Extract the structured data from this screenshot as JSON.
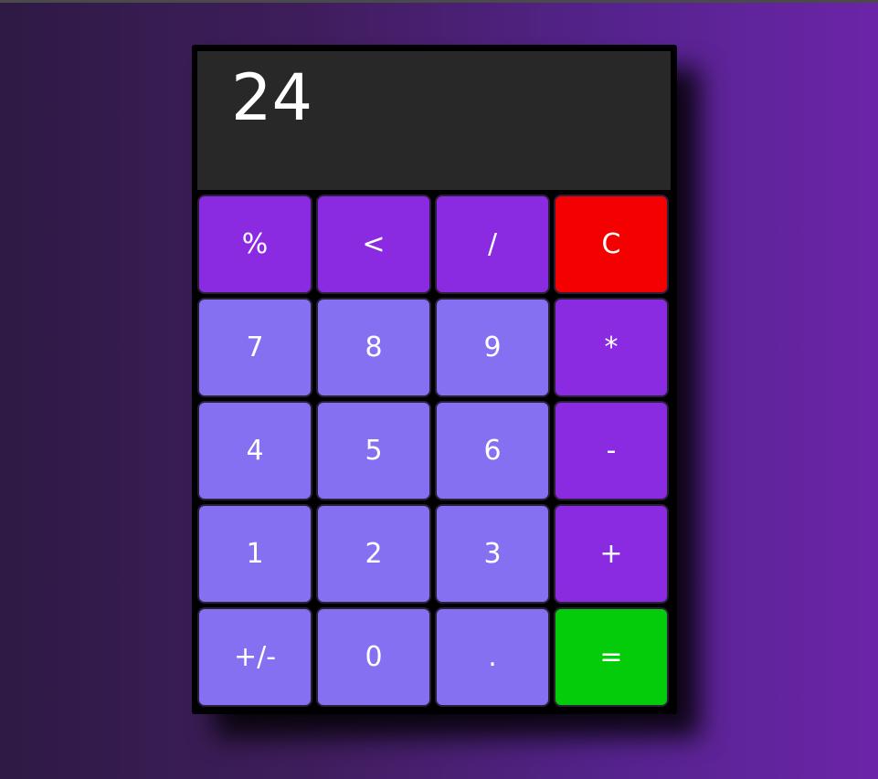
{
  "calculator": {
    "display_value": "24",
    "keys": [
      {
        "label": "%",
        "kind": "op",
        "name": "percent-button"
      },
      {
        "label": "<",
        "kind": "op",
        "name": "backspace-button"
      },
      {
        "label": "/",
        "kind": "op",
        "name": "divide-button"
      },
      {
        "label": "C",
        "kind": "clear",
        "name": "clear-button"
      },
      {
        "label": "7",
        "kind": "num",
        "name": "digit-7-button"
      },
      {
        "label": "8",
        "kind": "num",
        "name": "digit-8-button"
      },
      {
        "label": "9",
        "kind": "num",
        "name": "digit-9-button"
      },
      {
        "label": "*",
        "kind": "op",
        "name": "multiply-button"
      },
      {
        "label": "4",
        "kind": "num",
        "name": "digit-4-button"
      },
      {
        "label": "5",
        "kind": "num",
        "name": "digit-5-button"
      },
      {
        "label": "6",
        "kind": "num",
        "name": "digit-6-button"
      },
      {
        "label": "-",
        "kind": "op",
        "name": "subtract-button"
      },
      {
        "label": "1",
        "kind": "num",
        "name": "digit-1-button"
      },
      {
        "label": "2",
        "kind": "num",
        "name": "digit-2-button"
      },
      {
        "label": "3",
        "kind": "num",
        "name": "digit-3-button"
      },
      {
        "label": "+",
        "kind": "op",
        "name": "add-button"
      },
      {
        "label": "+/-",
        "kind": "num",
        "name": "toggle-sign-button"
      },
      {
        "label": "0",
        "kind": "num",
        "name": "digit-0-button"
      },
      {
        "label": ".",
        "kind": "num",
        "name": "decimal-button"
      },
      {
        "label": "=",
        "kind": "equals",
        "name": "equals-button"
      }
    ]
  },
  "colors": {
    "operator_key": "#8a2be2",
    "digit_key": "#8470f0",
    "clear_key": "#f50000",
    "equals_key": "#04cc0a",
    "display_background": "#282828",
    "body_background": "#000000"
  }
}
